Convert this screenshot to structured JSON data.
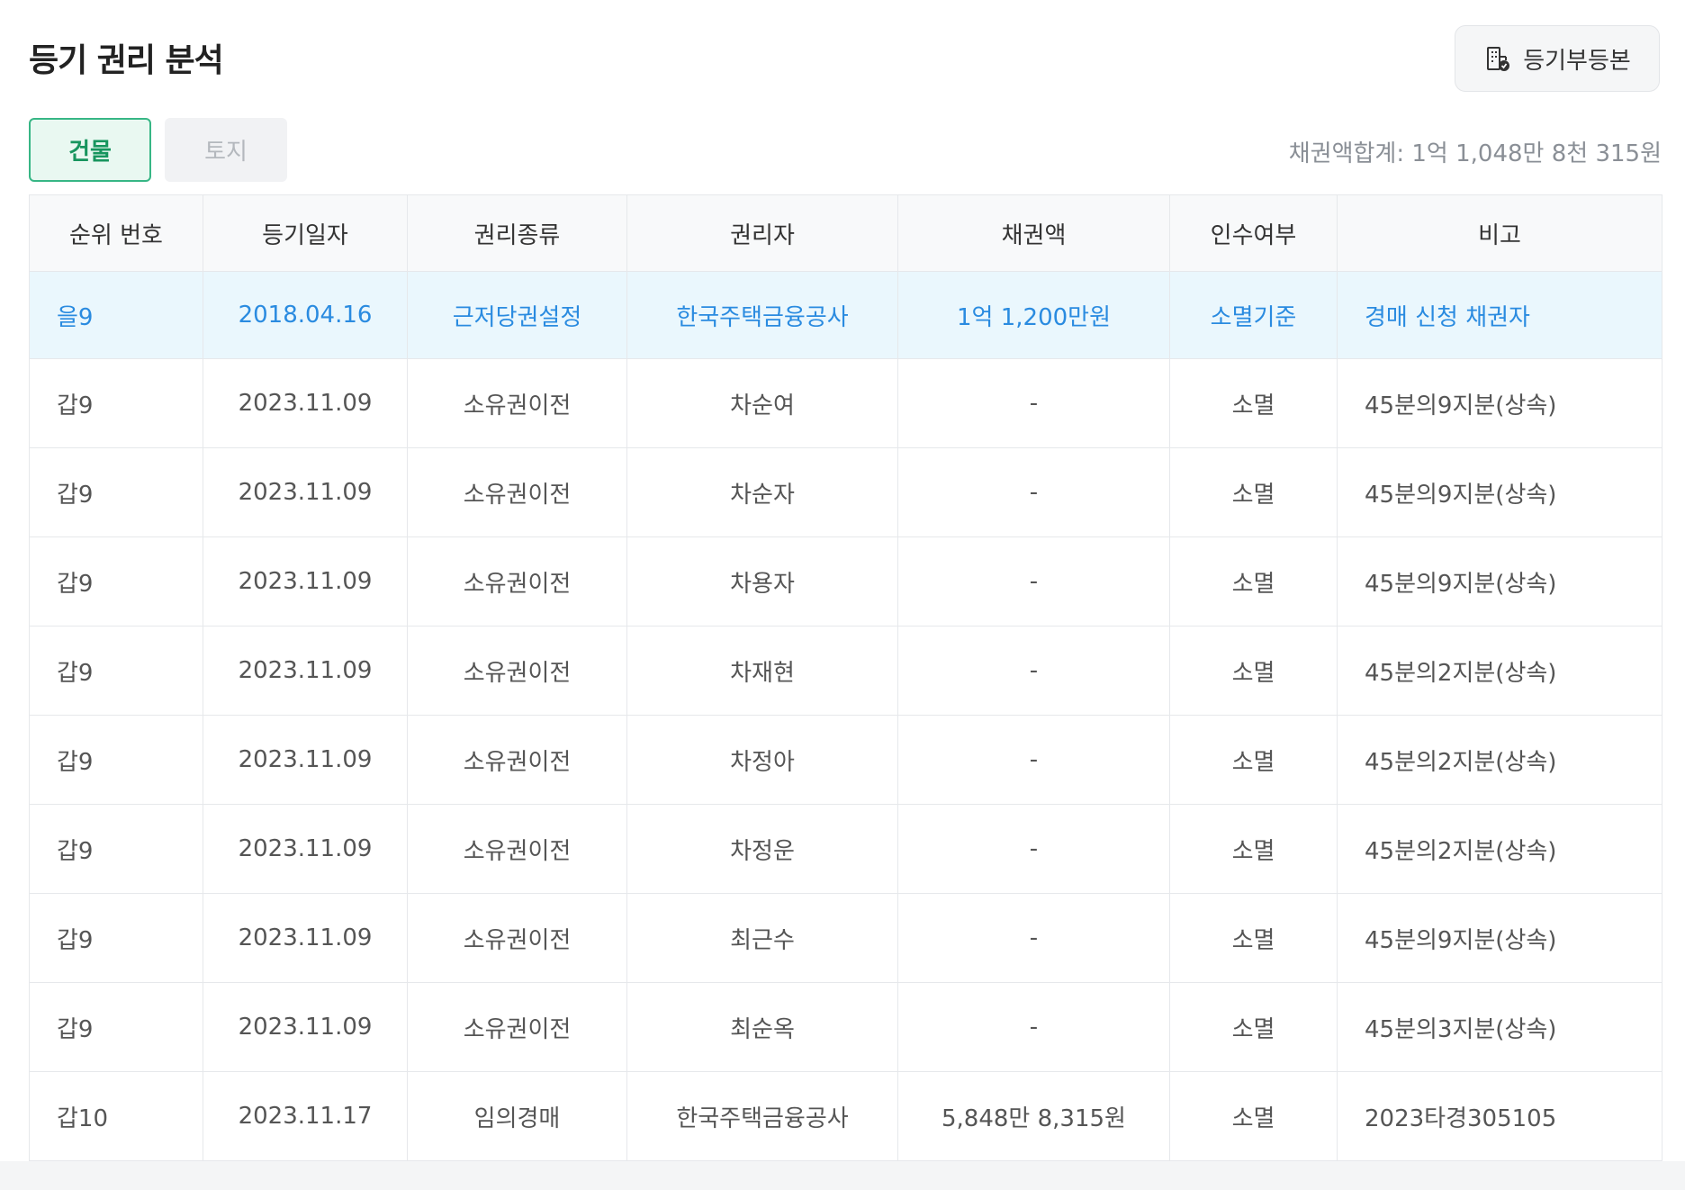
{
  "header": {
    "title": "등기 권리 분석",
    "doc_button_label": "등기부등본"
  },
  "tabs": [
    {
      "label": "건물",
      "active": true
    },
    {
      "label": "토지",
      "active": false
    }
  ],
  "summary": {
    "label": "채권액합계:",
    "amount": "1억 1,048만 8천 315원"
  },
  "colors": {
    "accent_green": "#17955e",
    "highlight_blue": "#2a8be0",
    "highlight_bg": "#eaf7fd"
  },
  "table": {
    "columns": [
      "순위 번호",
      "등기일자",
      "권리종류",
      "권리자",
      "채권액",
      "인수여부",
      "비고"
    ],
    "rows": [
      {
        "rank": "을9",
        "date": "2018.04.16",
        "type": "근저당권설정",
        "holder": "한국주택금융공사",
        "amount": "1억 1,200만원",
        "takeover": "소멸기준",
        "note": "경매 신청 채권자",
        "highlight": true
      },
      {
        "rank": "갑9",
        "date": "2023.11.09",
        "type": "소유권이전",
        "holder": "차순여",
        "amount": "-",
        "takeover": "소멸",
        "note": "45분의9지분(상속)"
      },
      {
        "rank": "갑9",
        "date": "2023.11.09",
        "type": "소유권이전",
        "holder": "차순자",
        "amount": "-",
        "takeover": "소멸",
        "note": "45분의9지분(상속)"
      },
      {
        "rank": "갑9",
        "date": "2023.11.09",
        "type": "소유권이전",
        "holder": "차용자",
        "amount": "-",
        "takeover": "소멸",
        "note": "45분의9지분(상속)"
      },
      {
        "rank": "갑9",
        "date": "2023.11.09",
        "type": "소유권이전",
        "holder": "차재현",
        "amount": "-",
        "takeover": "소멸",
        "note": "45분의2지분(상속)"
      },
      {
        "rank": "갑9",
        "date": "2023.11.09",
        "type": "소유권이전",
        "holder": "차정아",
        "amount": "-",
        "takeover": "소멸",
        "note": "45분의2지분(상속)"
      },
      {
        "rank": "갑9",
        "date": "2023.11.09",
        "type": "소유권이전",
        "holder": "차정운",
        "amount": "-",
        "takeover": "소멸",
        "note": "45분의2지분(상속)"
      },
      {
        "rank": "갑9",
        "date": "2023.11.09",
        "type": "소유권이전",
        "holder": "최근수",
        "amount": "-",
        "takeover": "소멸",
        "note": "45분의9지분(상속)"
      },
      {
        "rank": "갑9",
        "date": "2023.11.09",
        "type": "소유권이전",
        "holder": "최순옥",
        "amount": "-",
        "takeover": "소멸",
        "note": "45분의3지분(상속)"
      },
      {
        "rank": "갑10",
        "date": "2023.11.17",
        "type": "임의경매",
        "holder": "한국주택금융공사",
        "amount": "5,848만 8,315원",
        "takeover": "소멸",
        "note": "2023타경305105"
      }
    ]
  }
}
